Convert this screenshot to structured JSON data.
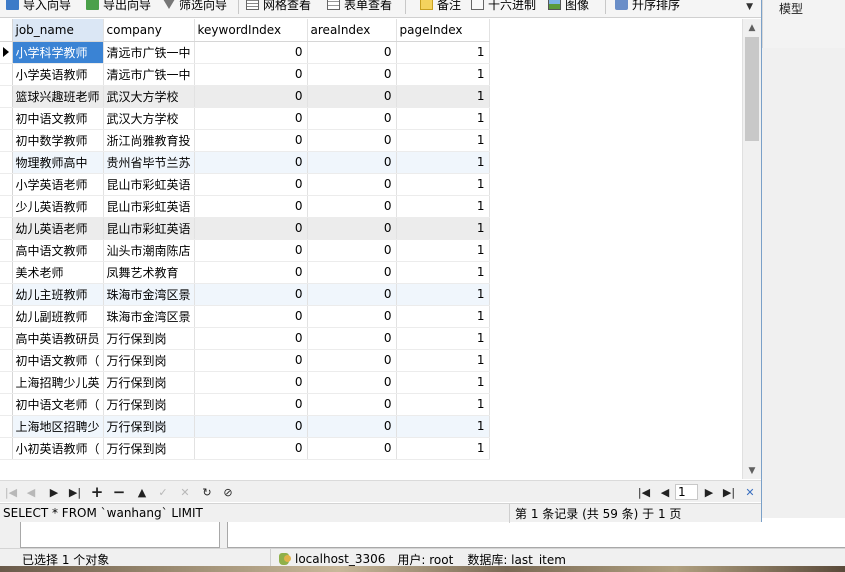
{
  "toolbar": {
    "import": "导入向导",
    "export": "导出向导",
    "filter": "筛选向导",
    "grid_view": "网格查看",
    "form_view": "表单查看",
    "note": "备注",
    "hex": "十六进制",
    "image": "图像",
    "sort": "升序排序"
  },
  "side_label": "模型",
  "grid": {
    "columns": [
      "job_name",
      "company",
      "keywordIndex",
      "areaIndex",
      "pageIndex"
    ],
    "rows": [
      [
        "小学科学教师",
        "清远市广铁一中",
        "0",
        "0",
        "1"
      ],
      [
        "小学英语教师",
        "清远市广铁一中",
        "0",
        "0",
        "1"
      ],
      [
        "篮球兴趣班老师",
        "武汉大方学校",
        "0",
        "0",
        "1"
      ],
      [
        "初中语文教师",
        "武汉大方学校",
        "0",
        "0",
        "1"
      ],
      [
        "初中数学教师",
        "浙江尚雅教育投",
        "0",
        "0",
        "1"
      ],
      [
        "物理教师高中",
        "贵州省毕节兰苏",
        "0",
        "0",
        "1"
      ],
      [
        "小学英语老师",
        "昆山市彩虹英语",
        "0",
        "0",
        "1"
      ],
      [
        "少儿英语教师",
        "昆山市彩虹英语",
        "0",
        "0",
        "1"
      ],
      [
        "幼儿英语老师",
        "昆山市彩虹英语",
        "0",
        "0",
        "1"
      ],
      [
        "高中语文教师",
        "汕头市潮南陈店",
        "0",
        "0",
        "1"
      ],
      [
        "美术老师",
        "凤舞艺术教育",
        "0",
        "0",
        "1"
      ],
      [
        "幼儿主班教师",
        "珠海市金湾区景",
        "0",
        "0",
        "1"
      ],
      [
        "幼儿副班教师",
        "珠海市金湾区景",
        "0",
        "0",
        "1"
      ],
      [
        "高中英语教研员",
        "万行保到岗",
        "0",
        "0",
        "1"
      ],
      [
        "初中语文教师（",
        "万行保到岗",
        "0",
        "0",
        "1"
      ],
      [
        "上海招聘少儿英",
        "万行保到岗",
        "0",
        "0",
        "1"
      ],
      [
        "初中语文老师（",
        "万行保到岗",
        "0",
        "0",
        "1"
      ],
      [
        "上海地区招聘少",
        "万行保到岗",
        "0",
        "0",
        "1"
      ],
      [
        "小初英语教师（",
        "万行保到岗",
        "0",
        "0",
        "1"
      ]
    ]
  },
  "navigation": {
    "page": "1"
  },
  "window_status": {
    "sql": "SELECT * FROM `wanhang` LIMIT",
    "record": "第 1 条记录 (共 59 条) 于 1 页"
  },
  "app_status": {
    "selection": "已选择 1 个对象",
    "connection": "localhost_3306",
    "user": "用户: root",
    "database": "数据库: last_item"
  }
}
